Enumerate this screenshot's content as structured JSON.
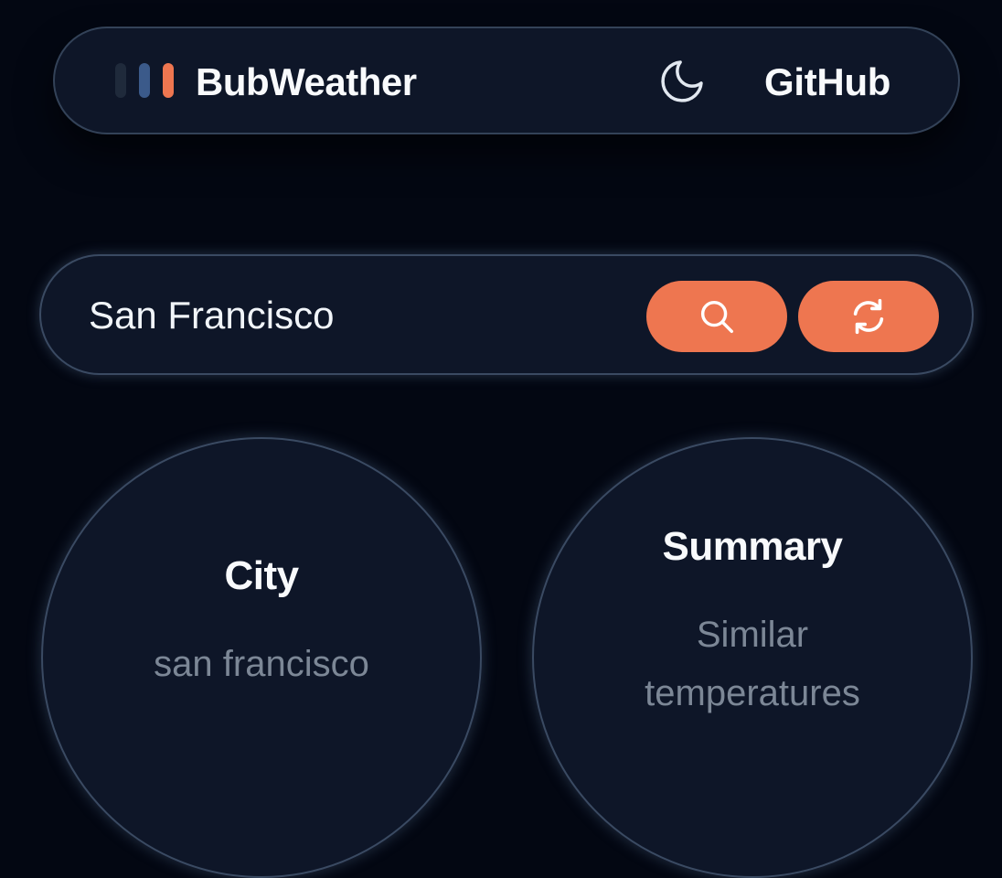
{
  "header": {
    "app_name": "BubWeather",
    "logo_colors": [
      "#1f2a3b",
      "#3b5a8a",
      "#ee7650"
    ],
    "theme_toggle_icon": "moon-icon",
    "github_label": "GitHub"
  },
  "search": {
    "value": "San Francisco",
    "search_button_icon": "search-icon",
    "refresh_button_icon": "refresh-icon"
  },
  "cards": [
    {
      "title": "City",
      "value": "san francisco"
    },
    {
      "title": "Summary",
      "value": "Similar temperatures"
    }
  ],
  "colors": {
    "background": "#030712",
    "surface": "#0e1628",
    "border": "#3a4a62",
    "accent": "#ee7650",
    "text": "#f8fafc",
    "muted_text": "#7c8796"
  }
}
